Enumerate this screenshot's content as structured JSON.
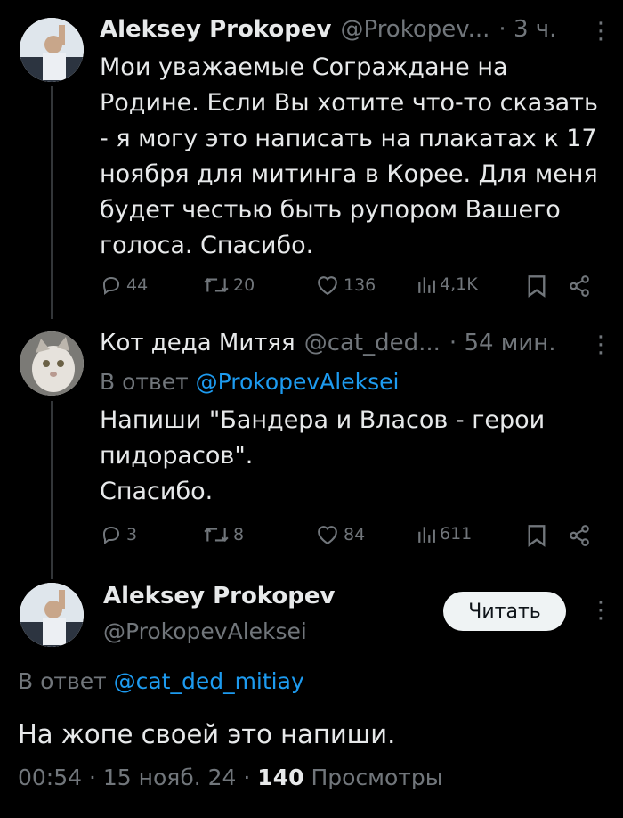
{
  "tweet1": {
    "name": "Aleksey Prokopev",
    "handle": "@Prokopev...",
    "time": "· 3 ч.",
    "text": "Мои уважаемые Сограждане на\nРодине. Если Вы хотите что-то сказать\n- я могу это написать на плакатах к 17\nноября для митинга в Корее. Для меня\nбудет честью быть рупором Вашего\nголоса. Спасибо.",
    "replies": "44",
    "retweets": "20",
    "likes": "136",
    "views": "4,1K"
  },
  "tweet2": {
    "name": "Кот деда Митяя",
    "handle": "@cat_ded...",
    "time": "· 54 мин.",
    "reply_prefix": "В ответ",
    "reply_link": "@ProkopevAleksei",
    "text": "Напиши \"Бандера и Власов - герои\nпидорасов\".\nСпасибо.",
    "replies": "3",
    "retweets": "8",
    "likes": "84",
    "views": "611"
  },
  "tweet3": {
    "name": "Aleksey Prokopev",
    "handle": "@ProkopevAleksei",
    "follow_label": "Читать",
    "reply_prefix": "В ответ",
    "reply_link": "@cat_ded_mitiay",
    "text": "На жопе своей это напиши.",
    "timestamp": "00:54 · 15 нояб. 24 ·",
    "views_count": "140",
    "views_label": "Просмотры"
  },
  "icons": {
    "more": "more-dots-icon",
    "reply": "reply-icon",
    "retweet": "retweet-icon",
    "like": "heart-icon",
    "views": "views-chart-icon",
    "bookmark": "bookmark-icon",
    "share": "share-icon"
  }
}
